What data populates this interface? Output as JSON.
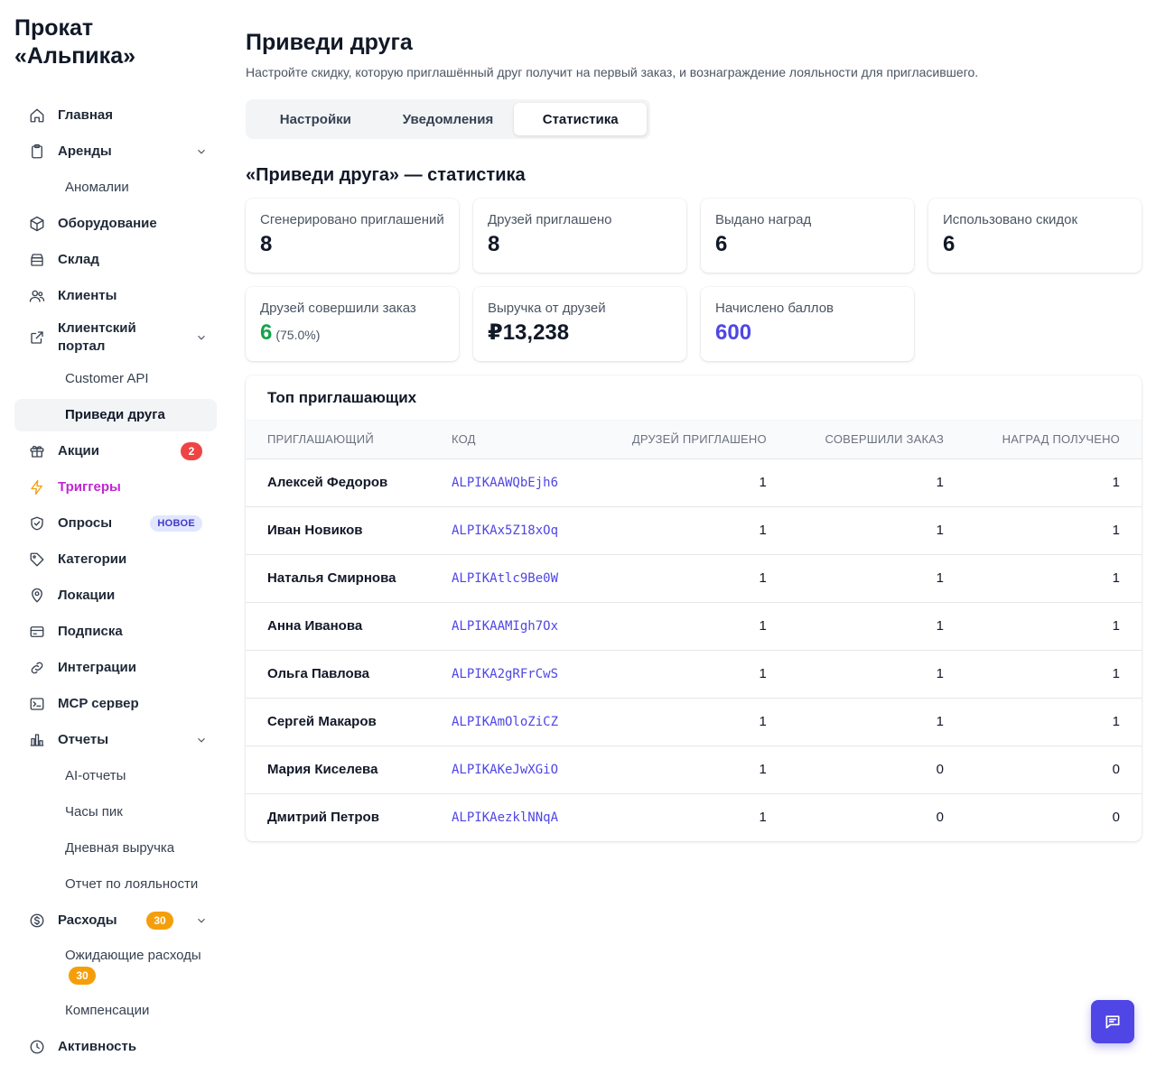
{
  "brand": "Прокат «Альпика»",
  "sidebar": {
    "home": "Главная",
    "rentals": "Аренды",
    "anomalies": "Аномалии",
    "equipment": "Оборудование",
    "warehouse": "Склад",
    "clients": "Клиенты",
    "client_portal": "Клиентский портал",
    "customer_api": "Customer API",
    "refer_friend": "Приведи друга",
    "promotions": "Акции",
    "promotions_badge": "2",
    "triggers": "Триггеры",
    "surveys": "Опросы",
    "surveys_badge": "НОВОЕ",
    "categories": "Категории",
    "locations": "Локации",
    "subscription": "Подписка",
    "integrations": "Интеграции",
    "mcp_server": "MCP сервер",
    "reports": "Отчеты",
    "ai_reports": "AI-отчеты",
    "peak_hours": "Часы пик",
    "daily_revenue": "Дневная выручка",
    "loyalty_report": "Отчет по лояльности",
    "expenses": "Расходы",
    "expenses_badge": "30",
    "pending_expenses": "Ожидающие расходы",
    "pending_badge": "30",
    "compensations": "Компенсации",
    "activity": "Активность"
  },
  "header": {
    "title": "Приведи друга",
    "description": "Настройте скидку, которую приглашённый друг получит на первый заказ, и вознаграждение лояльности для пригласившего."
  },
  "tabs": {
    "settings": "Настройки",
    "notifications": "Уведомления",
    "statistics": "Статистика"
  },
  "stats": {
    "title": "«Приведи друга» — статистика",
    "generated_label": "Сгенерировано приглашений",
    "generated_value": "8",
    "invited_label": "Друзей приглашено",
    "invited_value": "8",
    "rewards_label": "Выдано наград",
    "rewards_value": "6",
    "discounts_label": "Использовано скидок",
    "discounts_value": "6",
    "ordered_label": "Друзей совершили заказ",
    "ordered_value": "6",
    "ordered_pct": "(75.0%)",
    "revenue_label": "Выручка от друзей",
    "revenue_value": "₽13,238",
    "points_label": "Начислено баллов",
    "points_value": "600"
  },
  "top_table": {
    "title": "Топ приглашающих",
    "columns": {
      "referrer": "Приглашающий",
      "code": "Код",
      "invited": "Друзей приглашено",
      "ordered": "Совершили заказ",
      "rewards": "Наград получено"
    },
    "rows": [
      {
        "name": "Алексей Федоров",
        "code": "ALPIKAAWQbEjh6",
        "invited": "1",
        "ordered": "1",
        "rewards": "1"
      },
      {
        "name": "Иван Новиков",
        "code": "ALPIKAx5Z18xOq",
        "invited": "1",
        "ordered": "1",
        "rewards": "1"
      },
      {
        "name": "Наталья Смирнова",
        "code": "ALPIKAtlc9Be0W",
        "invited": "1",
        "ordered": "1",
        "rewards": "1"
      },
      {
        "name": "Анна Иванова",
        "code": "ALPIKAAMIgh7Ox",
        "invited": "1",
        "ordered": "1",
        "rewards": "1"
      },
      {
        "name": "Ольга Павлова",
        "code": "ALPIKA2gRFrCwS",
        "invited": "1",
        "ordered": "1",
        "rewards": "1"
      },
      {
        "name": "Сергей Макаров",
        "code": "ALPIKAmOloZiCZ",
        "invited": "1",
        "ordered": "1",
        "rewards": "1"
      },
      {
        "name": "Мария Киселева",
        "code": "ALPIKAKeJwXGiO",
        "invited": "1",
        "ordered": "0",
        "rewards": "0"
      },
      {
        "name": "Дмитрий Петров",
        "code": "ALPIKAezklNNqA",
        "invited": "1",
        "ordered": "0",
        "rewards": "0"
      }
    ]
  },
  "colors": {
    "accent": "#4f46e5",
    "success": "#16a34a",
    "danger": "#ef4444",
    "warning": "#f59e0b",
    "trigger": "#c026d3"
  }
}
